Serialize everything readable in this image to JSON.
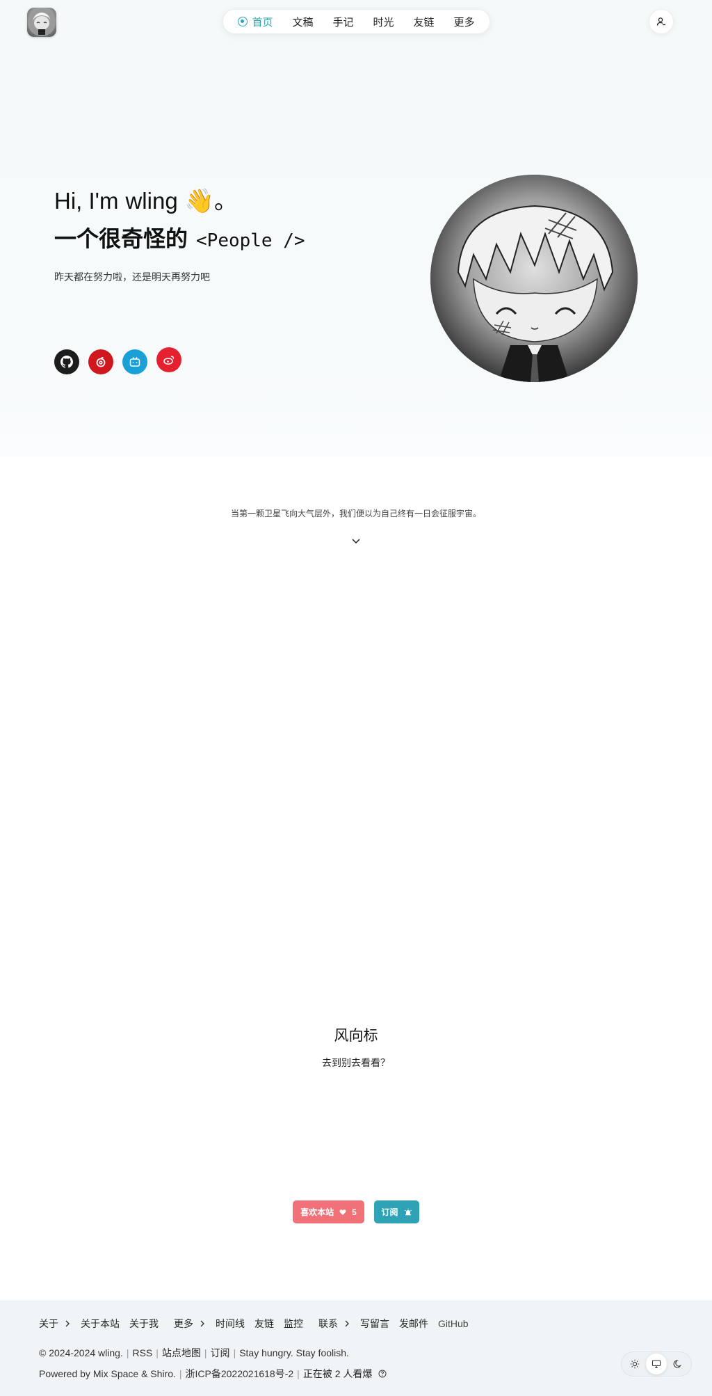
{
  "header": {
    "nav": [
      {
        "label": "首页",
        "active": true
      },
      {
        "label": "文稿"
      },
      {
        "label": "手记"
      },
      {
        "label": "时光"
      },
      {
        "label": "友链"
      },
      {
        "label": "更多"
      }
    ],
    "user_icon": "user-icon"
  },
  "hero": {
    "greeting_prefix": "Hi, I'm",
    "name": "wling",
    "wave": "👋",
    "greeting_suffix": "。",
    "tagline": "一个很奇怪的",
    "tagline_code": "<People />",
    "motto": "昨天都在努力啦，还是明天再努力吧",
    "socials": [
      {
        "icon": "github-icon",
        "color": "#1c1c1c"
      },
      {
        "icon": "netease-music-icon",
        "color": "#d0171e"
      },
      {
        "icon": "bilibili-icon",
        "color": "#1aa0d6"
      },
      {
        "icon": "weibo-icon",
        "color": "#e5212f"
      }
    ]
  },
  "quote": "当第一颗卫星飞向大气层外，我们便以为自己终有一日会征服宇宙。",
  "windvane": {
    "title": "风向标",
    "subtitle": "去到别去看看？"
  },
  "actions": {
    "like_label": "喜欢本站",
    "like_count": "5",
    "subscribe_label": "订阅"
  },
  "footer": {
    "groups": [
      {
        "head": "关于",
        "links": [
          "关于本站",
          "关于我"
        ]
      },
      {
        "head": "更多",
        "links": [
          "时间线",
          "友链",
          "监控"
        ]
      },
      {
        "head": "联系",
        "links": [
          "写留言",
          "发邮件",
          "GitHub"
        ]
      }
    ],
    "copyright": "© 2024-2024 wling.",
    "rss": "RSS",
    "sitemap": "站点地图",
    "subscribe": "订阅",
    "slogan": "Stay hungry. Stay foolish.",
    "powered": "Powered by Mix Space & Shiro.",
    "icp": "浙ICP备2022021618号-2",
    "viewers": "正在被 2 人看爆"
  },
  "colors": {
    "accent": "#2aa5b8",
    "like": "#f07178",
    "subscribe": "#2fa3b5"
  }
}
